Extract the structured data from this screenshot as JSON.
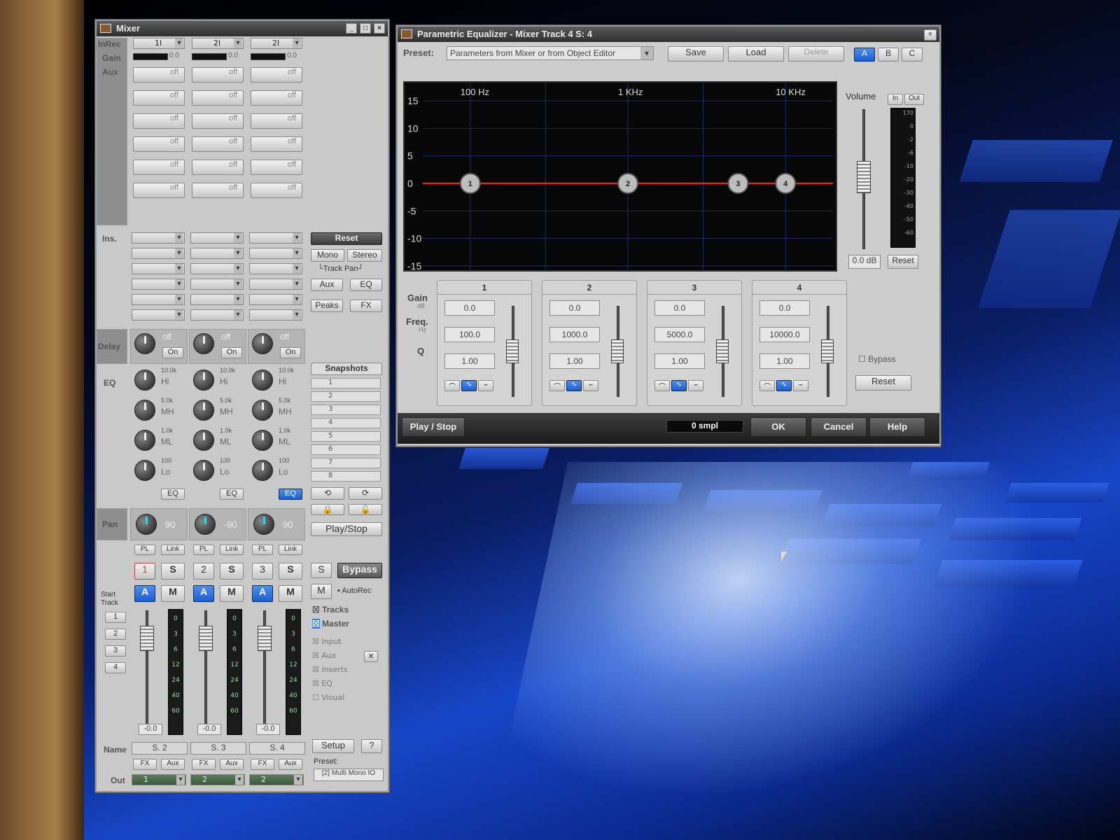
{
  "mixer": {
    "title": "Mixer",
    "win_controls": [
      "_",
      "□",
      "×"
    ],
    "row_labels": {
      "inrec": "InRec",
      "gain": "Gain",
      "aux": "Aux",
      "ins": "Ins.",
      "delay": "Delay",
      "eq": "EQ",
      "pan": "Pan",
      "name": "Name",
      "out": "Out",
      "start_track": "Start Track"
    },
    "channels": [
      {
        "inrec": "1l",
        "gain": "0.0",
        "delay": "off",
        "delay_btn": "On",
        "eq_hi": "10.0k",
        "eq_mh": "5.0k",
        "eq_ml": "1.0k",
        "eq_lo": "100",
        "eq_btn": "EQ",
        "pan": "90",
        "num": "1",
        "fader": "-0.0",
        "name": "S. 2",
        "out": "1"
      },
      {
        "inrec": "2l",
        "gain": "0.0",
        "delay": "off",
        "delay_btn": "On",
        "eq_hi": "10.0k",
        "eq_mh": "5.0k",
        "eq_ml": "1.0k",
        "eq_lo": "100",
        "eq_btn": "EQ",
        "pan": "-90",
        "num": "2",
        "fader": "-0.0",
        "name": "S. 3",
        "out": "2"
      },
      {
        "inrec": "2l",
        "gain": "0.0",
        "delay": "off",
        "delay_btn": "On",
        "eq_hi": "10.0k",
        "eq_mh": "5.0k",
        "eq_ml": "1.0k",
        "eq_lo": "100",
        "eq_btn": "EQ",
        "pan": "90",
        "num": "3",
        "fader": "-0.0",
        "name": "S. 4",
        "out": "2"
      }
    ],
    "aux_value": "off",
    "eq_band_labels": [
      "Hi",
      "MH",
      "ML",
      "Lo"
    ],
    "small_btns": {
      "pl": "PL",
      "link": "Link",
      "s": "S",
      "a": "A",
      "m": "M",
      "fx": "FX",
      "aux": "Aux"
    },
    "meter_scale": [
      "0",
      "3",
      "6",
      "12",
      "24",
      "40",
      "60"
    ],
    "start_tracks": [
      "1",
      "2",
      "3",
      "4"
    ],
    "right": {
      "reset": "Reset",
      "mono": "Mono",
      "stereo": "Stereo",
      "track_pan": "└Track Pan┘",
      "aux": "Aux",
      "eq": "EQ",
      "peaks": "Peaks",
      "fx": "FX",
      "snapshots": "Snapshots",
      "snaps": [
        "1",
        "2",
        "3",
        "4",
        "5",
        "6",
        "7",
        "8"
      ],
      "play_stop": "Play/Stop",
      "s": "S",
      "bypass": "Bypass",
      "m": "M",
      "autorec": "AutoRec",
      "tracks": "Tracks",
      "master": "Master",
      "checks": [
        "Input",
        "Aux",
        "Inserts",
        "EQ",
        "Visual"
      ],
      "setup": "Setup",
      "help": "?",
      "preset_label": "Preset:",
      "preset": "[2] Multi Mono IO"
    }
  },
  "eqwin": {
    "title": "Parametric Equalizer - Mixer Track 4 S: 4",
    "close": "×",
    "preset_label": "Preset:",
    "preset_value": "Parameters from Mixer or from Object Editor",
    "save": "Save",
    "load": "Load",
    "delete": "Delete",
    "abc": [
      "A",
      "B",
      "C"
    ],
    "freq_labels": [
      "100 Hz",
      "1 KHz",
      "10 KHz"
    ],
    "y_ticks": [
      "15",
      "10",
      "5",
      "0",
      "-5",
      "-10",
      "-15"
    ],
    "volume_label": "Volume",
    "in": "In",
    "out": "Out",
    "volume_value": "0.0 dB",
    "meter_reset": "Reset",
    "out_meter_scale": [
      "170",
      "0",
      "-2",
      "-6",
      "-10",
      "-20",
      "-30",
      "-40",
      "-50",
      "-60"
    ],
    "row_gain": "Gain",
    "row_gain_unit": "dB",
    "row_freq": "Freq.",
    "row_freq_unit": "Hz",
    "row_q": "Q",
    "bands": [
      {
        "num": "1",
        "gain": "0.0",
        "freq": "100.0",
        "q": "1.00"
      },
      {
        "num": "2",
        "gain": "0.0",
        "freq": "1000.0",
        "q": "1.00"
      },
      {
        "num": "3",
        "gain": "0.0",
        "freq": "5000.0",
        "q": "1.00"
      },
      {
        "num": "4",
        "gain": "0.0",
        "freq": "10000.0",
        "q": "1.00"
      }
    ],
    "bypass": "Bypass",
    "reset": "Reset",
    "play_stop": "Play / Stop",
    "latency": "0 smpl",
    "ok": "OK",
    "cancel": "Cancel",
    "help": "Help",
    "colors": {
      "curve": "#d62a2a",
      "graph_bg": "#070707",
      "grid": "#1c2b6e"
    }
  }
}
